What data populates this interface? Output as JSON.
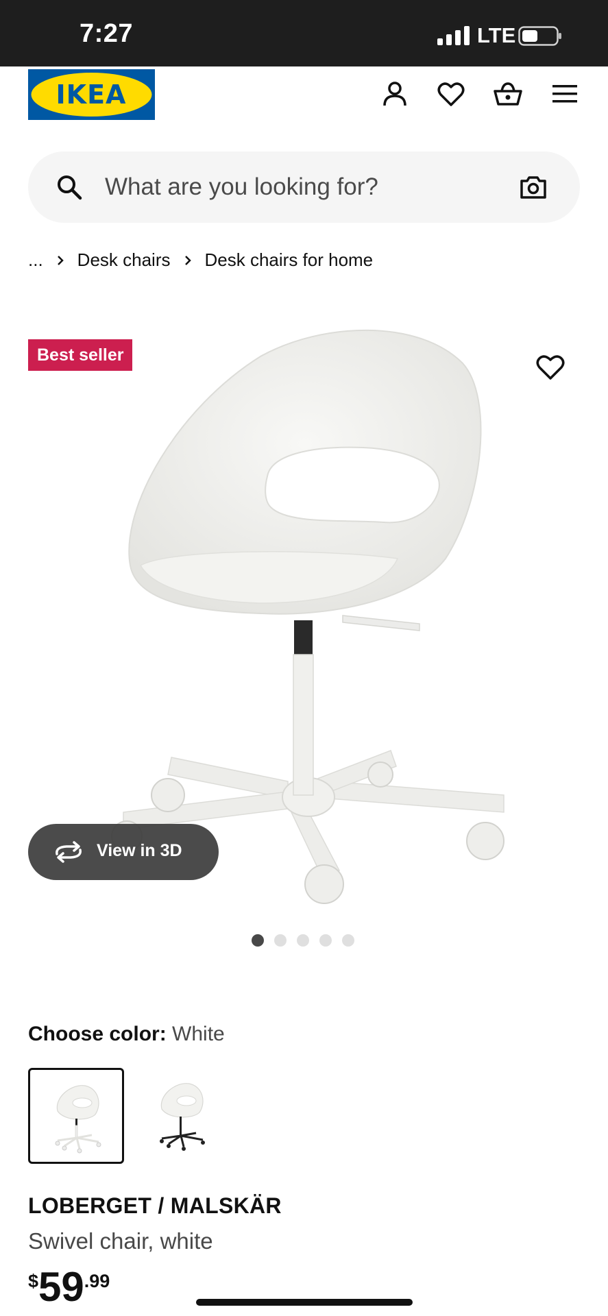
{
  "status_bar": {
    "time": "7:27",
    "network": "LTE"
  },
  "header": {
    "logo_text": "IKEA",
    "brand_colors": {
      "blue": "#0058a3",
      "yellow": "#ffdb00"
    }
  },
  "search": {
    "placeholder": "What are you looking for?"
  },
  "breadcrumb": {
    "ellipsis": "...",
    "items": [
      "Desk chairs",
      "Desk chairs for home"
    ]
  },
  "product_image": {
    "badge": "Best seller",
    "badge_color": "#cc1f4f",
    "view_3d_label": "View in 3D",
    "carousel_total": 5,
    "carousel_active": 1
  },
  "color_picker": {
    "label": "Choose color:",
    "selected": "White",
    "options": [
      "White",
      "Black"
    ]
  },
  "product": {
    "name": "LOBERGET / MALSKÄR",
    "description": "Swivel chair, white",
    "price": {
      "currency": "$",
      "integer": "59",
      "decimal": ".99"
    }
  }
}
